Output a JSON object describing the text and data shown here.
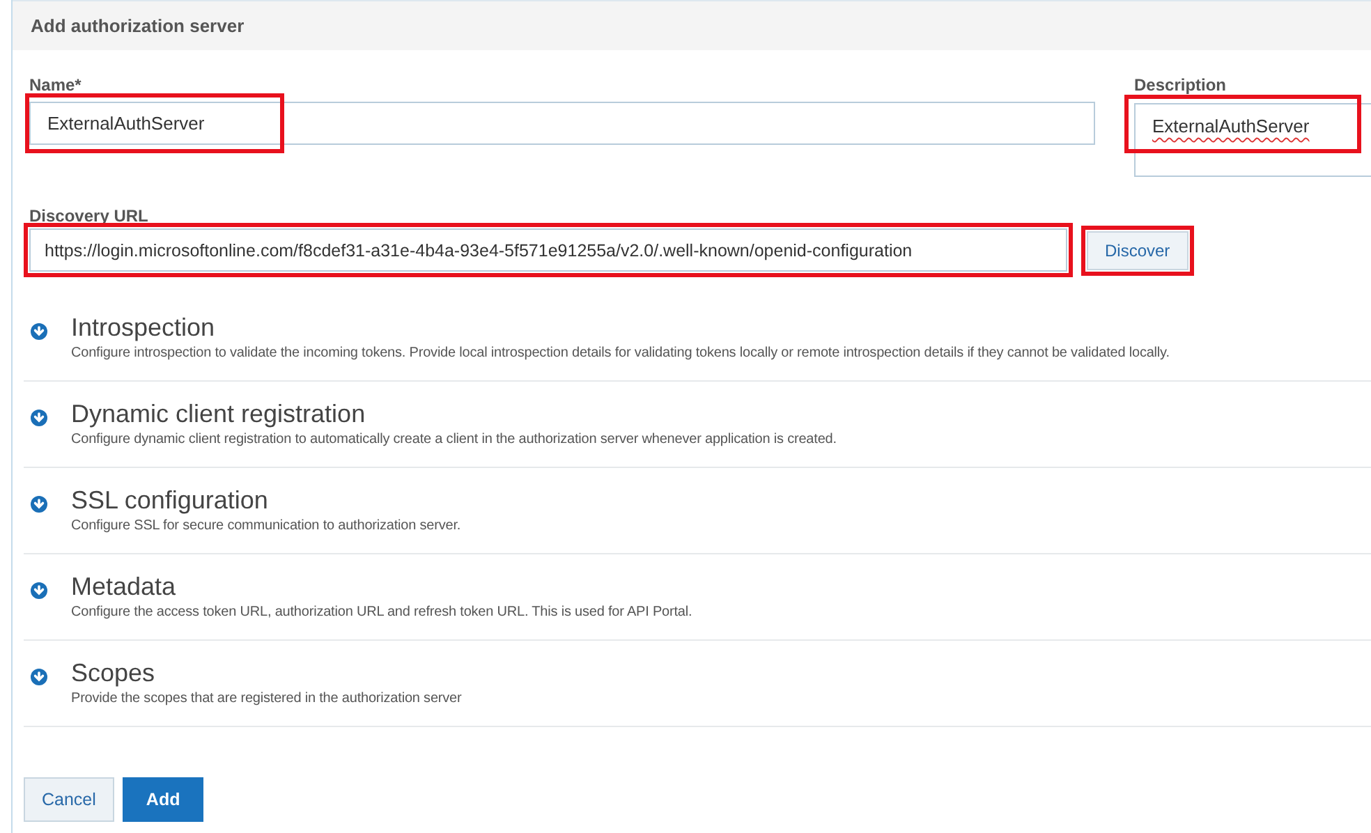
{
  "header": {
    "title": "Add authorization server"
  },
  "name_field": {
    "label": "Name*",
    "value": "ExternalAuthServer",
    "highlighted": true
  },
  "description_field": {
    "label": "Description",
    "value": "ExternalAuthServer",
    "highlighted": true
  },
  "discovery_field": {
    "label": "Discovery URL",
    "value": "https://login.microsoftonline.com/f8cdef31-a31e-4b4a-93e4-5f571e91255a/v2.0/.well-known/openid-configuration",
    "highlighted": true
  },
  "discover_button": {
    "label": "Discover",
    "highlighted": true
  },
  "sections": [
    {
      "title": "Introspection",
      "description": "Configure introspection to validate the incoming tokens. Provide local introspection details for validating tokens locally or remote introspection details if they cannot be validated locally.",
      "expanded": false
    },
    {
      "title": "Dynamic client registration",
      "description": "Configure dynamic client registration to automatically create a client in the authorization server whenever application is created.",
      "expanded": false
    },
    {
      "title": "SSL configuration",
      "description": "Configure SSL for secure communication to authorization server.",
      "expanded": false
    },
    {
      "title": "Metadata",
      "description": "Configure the access token URL, authorization URL and refresh token URL. This is used for API Portal.",
      "expanded": false
    },
    {
      "title": "Scopes",
      "description": "Provide the scopes that are registered in the authorization server",
      "expanded": false
    }
  ],
  "buttons": [
    {
      "label": "Cancel",
      "kind": "secondary"
    },
    {
      "label": "Add",
      "kind": "primary"
    }
  ]
}
